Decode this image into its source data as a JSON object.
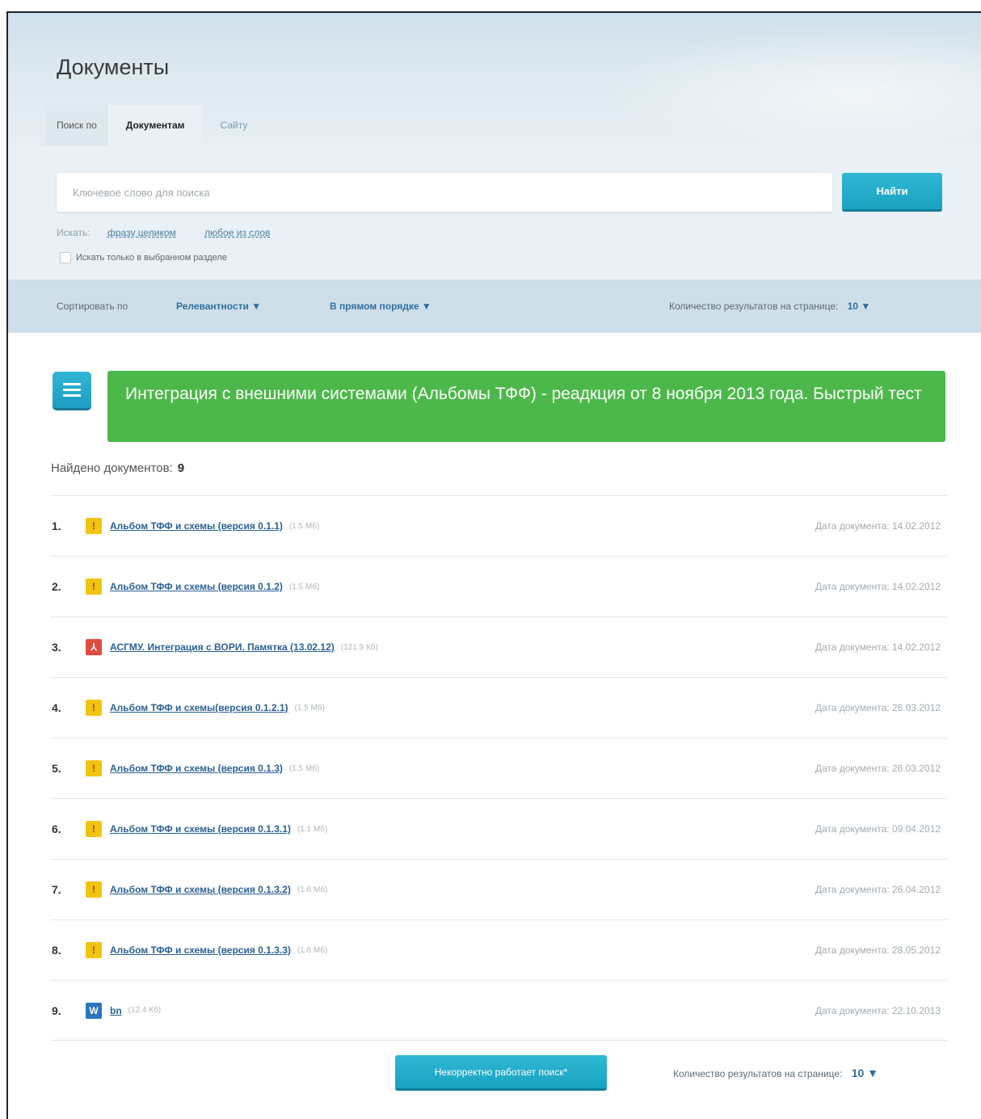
{
  "header": {
    "title": "Документы",
    "tab_prefix": "Поиск по",
    "tabs": [
      {
        "label": "Документам",
        "active": true
      },
      {
        "label": "Сайту",
        "active": false
      }
    ]
  },
  "search": {
    "placeholder": "Ключевое слово для поиска",
    "button_label": "Найти",
    "mode_label": "Искать:",
    "mode_phrase": "фразу целиком",
    "mode_any": "любое из слов",
    "section_only_label": "Искать только в выбранном разделе"
  },
  "sort": {
    "label": "Сортировать по",
    "relevance": "Релевантности ▼",
    "order": "В прямом порядке ▼",
    "per_page_label": "Количество результатов на странице:",
    "per_page_value": "10 ▼"
  },
  "document": {
    "title": "Интеграция с внешними системами (Альбомы ТФФ) - реадкция от 8 ноября 2013 года. Быстрый тест",
    "found_label": "Найдено документов:",
    "found_count": "9"
  },
  "results": [
    {
      "num": "1.",
      "icon": "archive-icon",
      "title": "Альбом ТФФ и схемы (версия 0.1.1)",
      "size": "(1.5 Мб)",
      "date": "Дата документа: 14.02.2012"
    },
    {
      "num": "2.",
      "icon": "archive-icon",
      "title": "Альбом ТФФ и схемы (версия 0.1.2)",
      "size": "(1.5 Мб)",
      "date": "Дата документа: 14.02.2012"
    },
    {
      "num": "3.",
      "icon": "pdf-icon",
      "title": "АСГМУ. Интеграция с ВОРИ. Памятка (13.02.12)",
      "size": "(121.9 Кб)",
      "date": "Дата документа: 14.02.2012"
    },
    {
      "num": "4.",
      "icon": "archive-icon",
      "title": "Альбом ТФФ и схемы(версия 0.1.2.1)",
      "size": "(1.5 Мб)",
      "date": "Дата документа: 26.03.2012"
    },
    {
      "num": "5.",
      "icon": "archive-icon",
      "title": "Альбом ТФФ и схемы (версия 0.1.3)",
      "size": "(1.5 Мб)",
      "date": "Дата документа: 26.03.2012"
    },
    {
      "num": "6.",
      "icon": "archive-icon",
      "title": "Альбом ТФФ и схемы (версия 0.1.3.1)",
      "size": "(1.1 Мб)",
      "date": "Дата документа: 09.04.2012"
    },
    {
      "num": "7.",
      "icon": "archive-icon",
      "title": "Альбом ТФФ и схемы (версия 0.1.3.2)",
      "size": "(1.6 Мб)",
      "date": "Дата документа: 26.04.2012"
    },
    {
      "num": "8.",
      "icon": "archive-icon",
      "title": "Альбом ТФФ и схемы (версия 0.1.3.3)",
      "size": "(1.6 Мб)",
      "date": "Дата документа: 28.05.2012"
    },
    {
      "num": "9.",
      "icon": "word-icon",
      "title": "bn",
      "size": "(12.4 Кб)",
      "date": "Дата документа: 22.10.2013"
    }
  ],
  "footer": {
    "report_button": "Некорректно работает поиск*",
    "per_page_label": "Количество результатов на странице:",
    "per_page_value": "10 ▼"
  },
  "icon_glyphs": {
    "archive-icon": "!",
    "pdf-icon": "⅄",
    "word-icon": "W"
  },
  "colors": {
    "accent": "#1aa3c1",
    "banner": "#4cb84a",
    "link": "#2b5f95"
  }
}
